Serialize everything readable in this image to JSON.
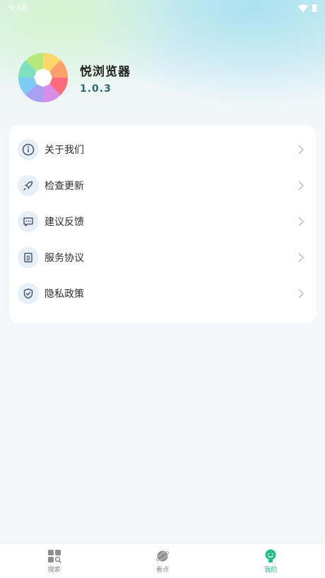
{
  "status_bar": {
    "time": "9:56"
  },
  "profile": {
    "app_name": "悦浏览器",
    "version": "1.0.3"
  },
  "menu": {
    "items": [
      {
        "label": "关于我们",
        "icon": "info-icon"
      },
      {
        "label": "检查更新",
        "icon": "rocket-icon"
      },
      {
        "label": "建议反馈",
        "icon": "feedback-icon"
      },
      {
        "label": "服务协议",
        "icon": "document-icon"
      },
      {
        "label": "隐私政策",
        "icon": "shield-icon"
      }
    ]
  },
  "tab_bar": {
    "tabs": [
      {
        "label": "搜索",
        "icon": "search-grid-icon",
        "active": false
      },
      {
        "label": "看点",
        "icon": "planet-icon",
        "active": false
      },
      {
        "label": "我的",
        "icon": "profile-icon",
        "active": true
      }
    ]
  },
  "colors": {
    "accent": "#1fbe87",
    "version_text": "#2a6a68",
    "icon_bg": "#e7f0f8",
    "icon_stroke": "#4a5a6a"
  }
}
